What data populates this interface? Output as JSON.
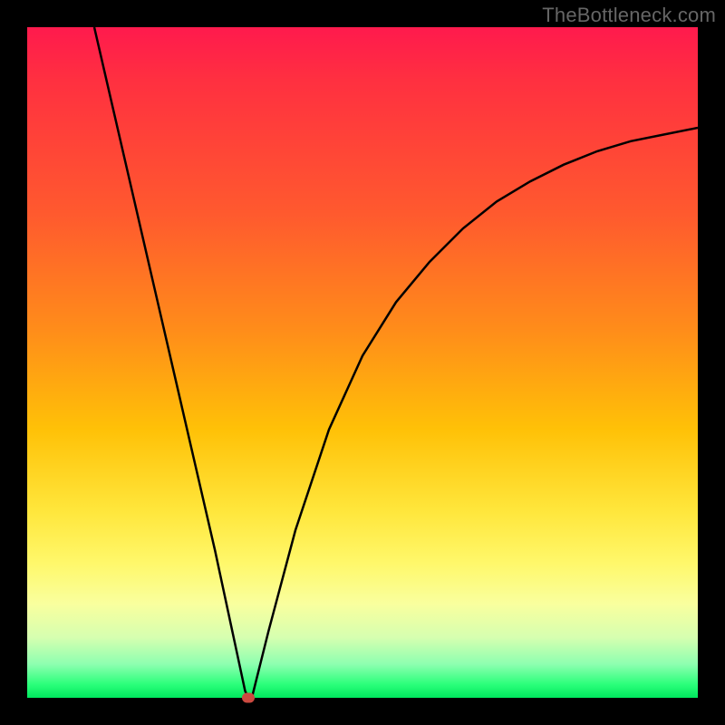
{
  "watermark": "TheBottleneck.com",
  "colors": {
    "frame": "#000000",
    "curve": "#000000",
    "marker": "#cc4a40",
    "gradient_stops": [
      "#ff1a4d",
      "#ff3040",
      "#ff5a2e",
      "#ff8c1a",
      "#ffc107",
      "#ffe63b",
      "#fff86b",
      "#f9ff9e",
      "#d6ffb0",
      "#8dffb0",
      "#2bff7a",
      "#00e85e"
    ]
  },
  "chart_data": {
    "type": "line",
    "title": "",
    "xlabel": "",
    "ylabel": "",
    "xlim": [
      0,
      100
    ],
    "ylim": [
      0,
      100
    ],
    "grid": false,
    "legend": false,
    "marker": {
      "x": 33,
      "y": 0
    },
    "series": [
      {
        "name": "curve",
        "x": [
          10,
          13,
          16,
          19,
          22,
          25,
          28,
          31,
          32.5,
          33,
          33.5,
          34,
          36,
          40,
          45,
          50,
          55,
          60,
          65,
          70,
          75,
          80,
          85,
          90,
          95,
          100
        ],
        "y": [
          100,
          87,
          74,
          61,
          48,
          35,
          22,
          8,
          1,
          0,
          0,
          2,
          10,
          25,
          40,
          51,
          59,
          65,
          70,
          74,
          77,
          79.5,
          81.5,
          83,
          84,
          85
        ]
      }
    ],
    "annotations": []
  }
}
